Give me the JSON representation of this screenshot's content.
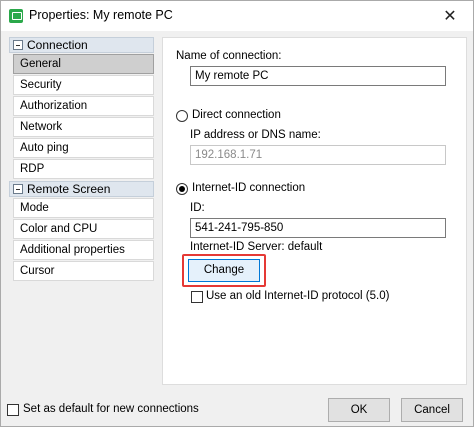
{
  "window": {
    "title": "Properties: My remote PC",
    "close_glyph": "✕"
  },
  "sidebar": {
    "groups": [
      {
        "label": "Connection",
        "items": [
          "General",
          "Security",
          "Authorization",
          "Network",
          "Auto ping",
          "RDP"
        ]
      },
      {
        "label": "Remote Screen",
        "items": [
          "Mode",
          "Color and CPU",
          "Additional properties",
          "Cursor"
        ]
      }
    ],
    "selected": "General"
  },
  "form": {
    "name_label": "Name of connection:",
    "name_value": "My remote PC",
    "direct_label": "Direct connection",
    "ip_label": "IP address or DNS name:",
    "ip_value": "192.168.1.71",
    "internet_id_label": "Internet-ID connection",
    "id_label": "ID:",
    "id_value": "541-241-795-850",
    "server_label": "Internet-ID Server: default",
    "change_label": "Change",
    "old_protocol_label": "Use an old Internet-ID protocol (5.0)",
    "selected_mode": "internet-id"
  },
  "footer": {
    "default_label": "Set as default for new connections",
    "ok_label": "OK",
    "cancel_label": "Cancel"
  },
  "colors": {
    "highlight": "#e53935",
    "focus_border": "#0078d7",
    "app_icon": "#2aa84a"
  }
}
